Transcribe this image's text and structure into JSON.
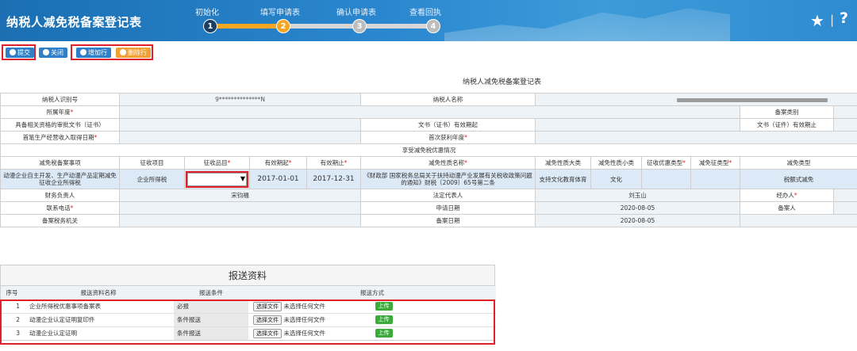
{
  "header": {
    "app_title": "纳税人减免税备案登记表",
    "steps": [
      {
        "number": "1",
        "label": "初始化"
      },
      {
        "number": "2",
        "label": "填写申请表"
      },
      {
        "number": "3",
        "label": "确认申请表"
      },
      {
        "number": "4",
        "label": "查看回执"
      }
    ],
    "separator": "|",
    "icons": {
      "favorite": "star-icon",
      "help": "help-icon"
    }
  },
  "toolbar": {
    "submit_label": "提交",
    "close_label": "关闭",
    "add_row_label": "增加行",
    "delete_row_label": "删除行"
  },
  "form": {
    "title": "纳税人减免税备案登记表",
    "taxpayer_id_label": "纳税人识别号",
    "taxpayer_id_value": "9**************N",
    "taxpayer_name_label": "纳税人名称",
    "year_label": "所属年度",
    "filing_type_label": "备案类别",
    "approval_doc_label": "具备相关资格的审批文书（证书）",
    "doc_valid_start_label": "文书（证书）有效期起",
    "doc_valid_end_label": "文书（证件）有效期止",
    "first_income_date_label": "首笔生产经营收入取得日期",
    "first_profit_year_label": "首次获利年度",
    "enjoy_section_label": "享受减免税优惠情况",
    "columns": {
      "item": "减免税备案事项",
      "tax_type": "征收项目",
      "tax_item": "征收品目",
      "valid_from": "有效期起",
      "valid_to": "有效期止",
      "nature_name": "减免性质名称",
      "nature_major": "减免性质大类",
      "nature_minor": "减免性质小类",
      "pref_type": "征收优惠类型",
      "cert_type": "减免征类型",
      "exempt_type": "减免类型"
    },
    "row": {
      "item": "动漫企业自主开发、生产动漫产品定期减免征收企业所得税",
      "tax_type": "企业所得税",
      "tax_item_value": "",
      "dropdown_arrow": "▼",
      "valid_from": "2017-01-01",
      "valid_to": "2017-12-31",
      "nature_name": "《财政部 国家税务总局关于扶持动漫产业发展有关税收政策问题的通知》财税〔2009〕65号第二条",
      "nature_major": "支持文化教育体育",
      "nature_minor": "文化",
      "exempt_type": "税额式减免"
    },
    "finance_lead_label": "财务负责人",
    "finance_lead_value": "宋钧福",
    "legal_rep_label": "法定代表人",
    "legal_rep_value": "刘玉山",
    "handler_label": "经办人",
    "phone_label": "联系电话",
    "apply_date_label": "申请日期",
    "apply_date_value": "2020-08-05",
    "filer_label": "备案人",
    "tax_office_label": "备案税务机关",
    "filing_date_label": "备案日期",
    "filing_date_value": "2020-08-05"
  },
  "attachments": {
    "title": "报送资料",
    "headers": {
      "no": "序号",
      "name": "报送资料名称",
      "condition": "报送条件",
      "method": "报送方式"
    },
    "choose_file_label": "选择文件",
    "no_file_label": "未选择任何文件",
    "upload_label": "上传",
    "rows": [
      {
        "no": "1",
        "name": "企业所得税优惠事项备案表",
        "condition": "必报"
      },
      {
        "no": "2",
        "name": "动漫企业认定证明复印件",
        "condition": "条件报送"
      },
      {
        "no": "3",
        "name": "动漫企业认定证明",
        "condition": "条件报送"
      }
    ]
  },
  "colors": {
    "header_blue": "#1b6fb2",
    "step_active": "#f5a623",
    "highlight_red": "#e0202a",
    "upload_green": "#3cab3c"
  }
}
